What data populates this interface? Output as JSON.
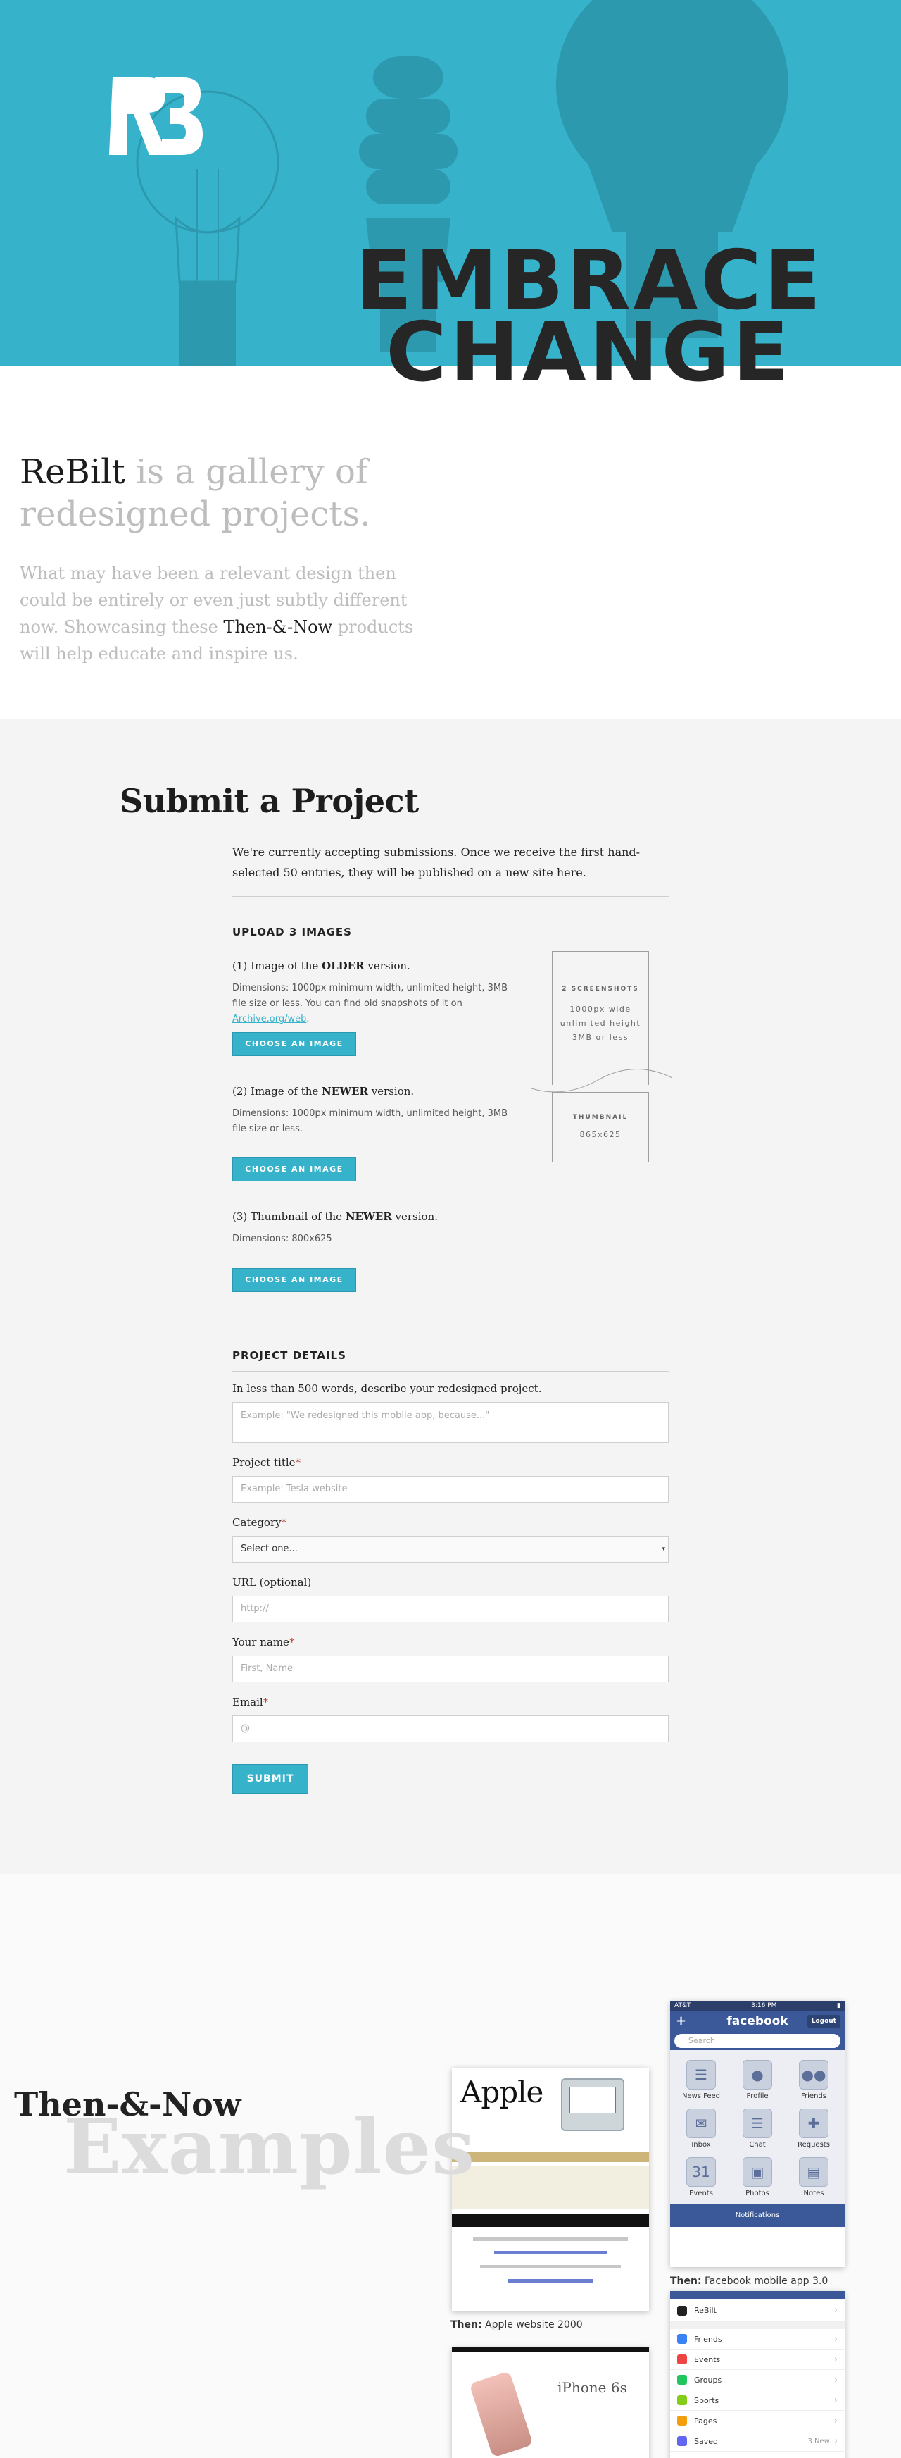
{
  "hero": {
    "title_line1": "EMBRACE",
    "title_line2": "CHANGE",
    "bg_color": "#36b3cb"
  },
  "intro": {
    "brand": "ReBilt",
    "lead_rest": " is a gallery of redesigned projects.",
    "desc_part1": "What may have been a relevant design then could be entirely or even just subtly different now. Showcasing these ",
    "desc_highlight": "Then-&-Now",
    "desc_part2": " products will help educate and inspire us."
  },
  "submit": {
    "heading": "Submit a Project",
    "intro_text": "We're currently accepting submissions. Once we receive the first hand-selected 50 entries, they will be published on a new site here.",
    "upload_title": "UPLOAD 3 IMAGES",
    "image1": {
      "label_pre": "(1) Image of the ",
      "label_bold": "OLDER",
      "label_post": " version.",
      "note": "Dimensions: 1000px minimum width, unlimited height, 3MB file size or less. You can find old snapshots of it on ",
      "link": "Archive.org/web",
      "note_end": ".",
      "button": "CHOOSE AN IMAGE"
    },
    "image2": {
      "label_pre": "(2) Image of the ",
      "label_bold": "NEWER",
      "label_post": " version.",
      "note": "Dimensions: 1000px minimum width, unlimited height, 3MB file size or less.",
      "button": "CHOOSE AN IMAGE"
    },
    "image3": {
      "label_pre": "(3) Thumbnail of the ",
      "label_bold": "NEWER",
      "label_post": " version.",
      "note": "Dimensions: 800x625",
      "button": "CHOOSE AN IMAGE"
    },
    "placeholder_screens": {
      "title": "2 SCREENSHOTS",
      "line1": "1000px wide",
      "line2": "unlimited height",
      "line3": "3MB or less"
    },
    "placeholder_thumb": {
      "title": "THUMBNAIL",
      "line1": "865x625"
    },
    "details_title": "PROJECT DETAILS",
    "describe_label": "In less than 500 words, describe your redesigned project.",
    "describe_placeholder": "Example: \"We redesigned this mobile app, because...\"",
    "title_label": "Project title",
    "title_placeholder": "Example: Tesla website",
    "category_label": "Category",
    "category_value": "Select one...",
    "url_label": "URL (optional)",
    "url_placeholder": "http://",
    "name_label": "Your name",
    "name_placeholder": "First, Name",
    "email_label": "Email",
    "email_placeholder": "@",
    "required_mark": "*",
    "submit_button": "SUBMIT"
  },
  "examples": {
    "title_small": "Then-&-Now",
    "title_big": "Examples",
    "apple_caption_bold": "Then:",
    "apple_caption_rest": " Apple website 2000",
    "apple_logo_text": "Apple",
    "fb_caption_bold": "Then:",
    "fb_caption_rest": " Facebook mobile app 3.0",
    "fb_status_left": "AT&T",
    "fb_status_time": "3:16 PM",
    "fb_logo": "facebook",
    "fb_logout": "Logout",
    "fb_search": "Search",
    "fb_items": [
      {
        "label": "News Feed",
        "icon": "news-feed-icon",
        "glyph": "☰"
      },
      {
        "label": "Profile",
        "icon": "profile-icon",
        "glyph": "●"
      },
      {
        "label": "Friends",
        "icon": "friends-icon",
        "glyph": "●●"
      },
      {
        "label": "Inbox",
        "icon": "inbox-icon",
        "glyph": "✉"
      },
      {
        "label": "Chat",
        "icon": "chat-icon",
        "glyph": "☰"
      },
      {
        "label": "Requests",
        "icon": "requests-icon",
        "glyph": "✚"
      },
      {
        "label": "Events",
        "icon": "events-icon",
        "glyph": "31"
      },
      {
        "label": "Photos",
        "icon": "photos-icon",
        "glyph": "▣"
      },
      {
        "label": "Notes",
        "icon": "notes-icon",
        "glyph": "▤"
      }
    ],
    "fb_notifications": "Notifications",
    "fb2_brand": "ReBilt",
    "fb2_items": [
      {
        "label": "Friends",
        "color": "#3b82f6",
        "meta": ""
      },
      {
        "label": "Events",
        "color": "#ef4444",
        "meta": ""
      },
      {
        "label": "Groups",
        "color": "#22c55e",
        "meta": ""
      },
      {
        "label": "Sports",
        "color": "#84cc16",
        "meta": ""
      },
      {
        "label": "Pages",
        "color": "#f59e0b",
        "meta": ""
      },
      {
        "label": "Saved",
        "color": "#6366f1",
        "meta": "3 New"
      }
    ],
    "iphone_text": "iPhone 6s"
  }
}
